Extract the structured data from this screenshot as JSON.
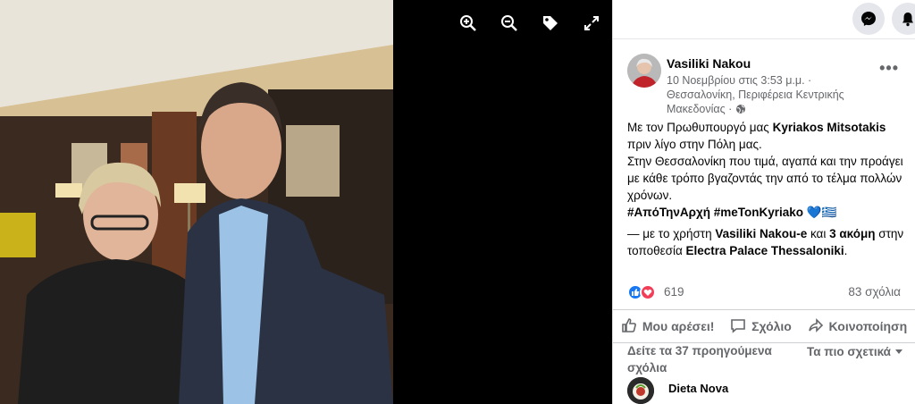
{
  "viewer": {
    "tools": [
      {
        "icon": "zoom-in-icon"
      },
      {
        "icon": "zoom-out-icon"
      },
      {
        "icon": "tag-icon"
      },
      {
        "icon": "fullscreen-icon"
      }
    ]
  },
  "topbar": {
    "buttons": [
      {
        "icon": "messenger-icon"
      },
      {
        "icon": "notifications-icon"
      }
    ]
  },
  "post": {
    "author": "Vasiliki Nakou",
    "date": "10 Νοεμβρίου στις 3:53 μ.μ. ·",
    "location": "Θεσσαλονίκη, Περιφέρεια Κεντρικής Μακεδονίας ·",
    "privacy_icon": "globe-icon",
    "more": "•••",
    "text": {
      "line1_prefix": "Με τον Πρωθυπουργό μας ",
      "line1_name": "Kyriakos Mitsotakis",
      "line2": "πριν λίγο στην Πόλη μας.",
      "line3": "Στην Θεσσαλονίκη που τιμά, αγαπά και την προάγει με κάθε τρόπο βγαζοντάς την από το τέλμα πολλών χρόνων.",
      "hashtag1": "#ΑπόΤηνΑρχή",
      "hashtag2": "#meTonKyriako",
      "emoji": "💙🇬🇷",
      "with_prefix": "— με το χρήστη ",
      "with_user": "Vasiliki Nakou-e",
      "with_and": " και ",
      "with_more": "3 ακόμη",
      "at_prefix": " στην τοποθεσία ",
      "at_place": "Electra Palace Thessaloniki",
      "at_suffix": "."
    }
  },
  "reactions": {
    "count": "619",
    "comments": "83 σχόλια"
  },
  "actions": {
    "like": "Μου αρέσει!",
    "comment": "Σχόλιο",
    "share": "Κοινοποίηση"
  },
  "comments_section": {
    "previous": "Δείτε τα 37 προηγούμενα σχόλια",
    "relevant": "Τα πιο σχετικά",
    "first_comment_author": "Dieta Nova"
  },
  "colors": {
    "accent": "#1877f2",
    "love": "#f33e58",
    "secondary_text": "#65676b"
  }
}
